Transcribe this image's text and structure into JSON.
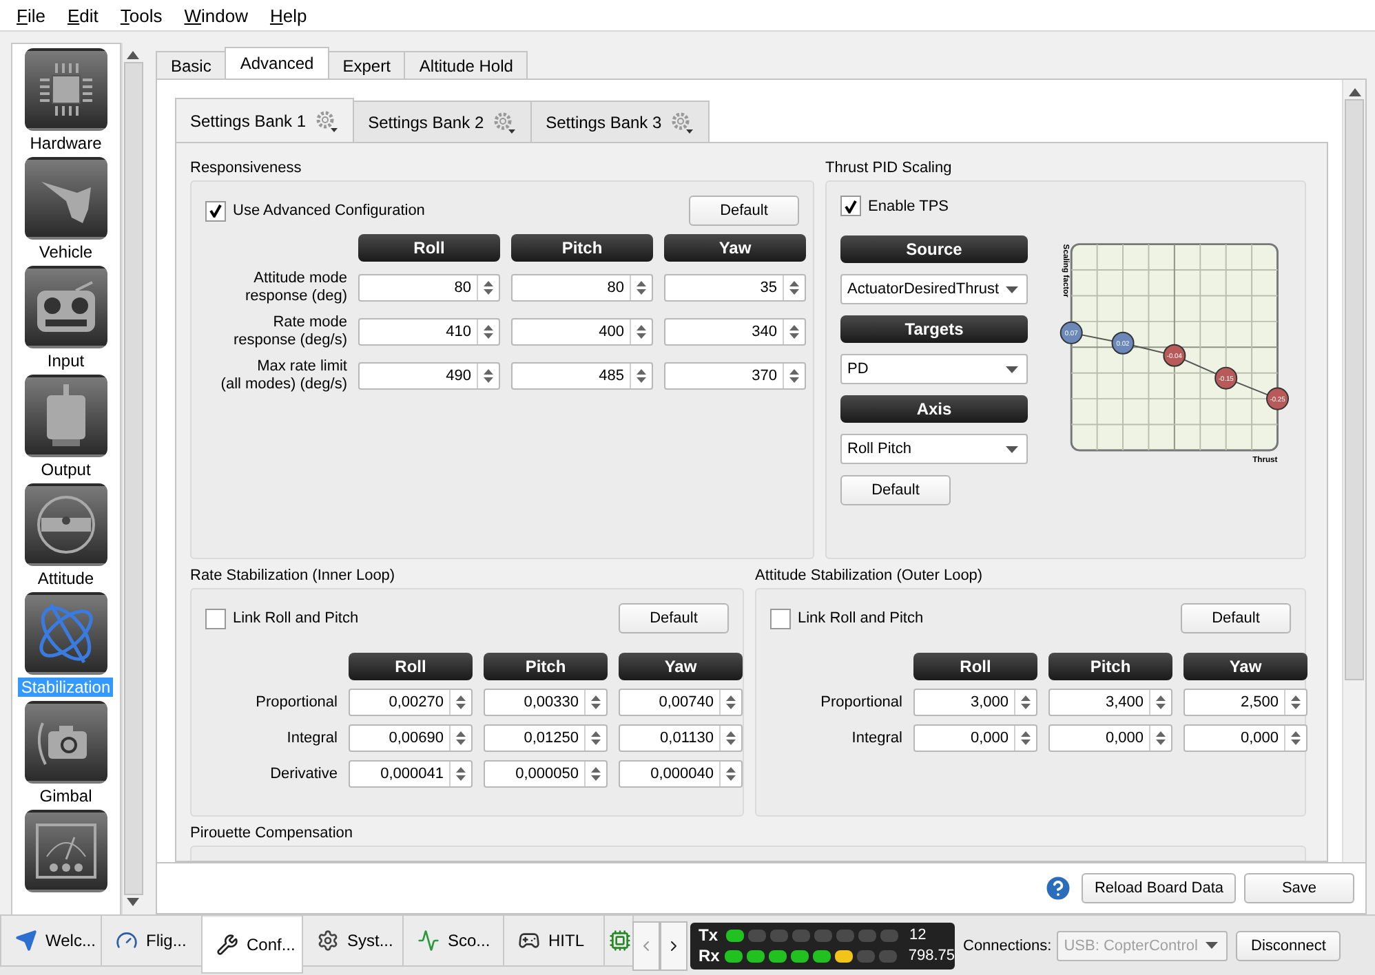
{
  "menu": [
    {
      "label": "File"
    },
    {
      "label": "Edit"
    },
    {
      "label": "Tools"
    },
    {
      "label": "Window"
    },
    {
      "label": "Help"
    }
  ],
  "sidebar": {
    "items": [
      {
        "label": "Hardware",
        "kind": "chip",
        "selected": false
      },
      {
        "label": "Vehicle",
        "kind": "plane",
        "selected": false
      },
      {
        "label": "Input",
        "kind": "radio",
        "selected": false
      },
      {
        "label": "Output",
        "kind": "motor",
        "selected": false
      },
      {
        "label": "Attitude",
        "kind": "level",
        "selected": false
      },
      {
        "label": "Stabilization",
        "kind": "gyro",
        "selected": true
      },
      {
        "label": "Gimbal",
        "kind": "camera",
        "selected": false
      },
      {
        "kind": "meter",
        "selected": false
      }
    ]
  },
  "tabs": [
    {
      "label": "Basic",
      "selected": false
    },
    {
      "label": "Advanced",
      "selected": true
    },
    {
      "label": "Expert",
      "selected": false
    },
    {
      "label": "Altitude Hold",
      "selected": false
    }
  ],
  "bank_tabs": [
    {
      "label": "Settings Bank 1",
      "selected": true
    },
    {
      "label": "Settings Bank 2",
      "selected": false
    },
    {
      "label": "Settings Bank 3",
      "selected": false
    }
  ],
  "responsiveness": {
    "title": "Responsiveness",
    "use_advanced": {
      "label": "Use Advanced Configuration",
      "checked": true
    },
    "default_button": "Default",
    "columns": [
      "Roll",
      "Pitch",
      "Yaw"
    ],
    "rows": [
      {
        "label": "Attitude mode\nresponse (deg)",
        "values": [
          "80",
          "80",
          "35"
        ]
      },
      {
        "label": "Rate mode\nresponse (deg/s)",
        "values": [
          "410",
          "400",
          "340"
        ]
      },
      {
        "label": "Max rate limit\n(all modes) (deg/s)",
        "values": [
          "490",
          "485",
          "370"
        ]
      }
    ]
  },
  "thrust_pid_scaling": {
    "title": "Thrust PID Scaling",
    "enable_tps": {
      "label": "Enable TPS",
      "checked": true
    },
    "source_header": "Source",
    "source_value": "ActuatorDesiredThrust",
    "targets_header": "Targets",
    "targets_value": "PD",
    "axis_header": "Axis",
    "axis_value": "Roll Pitch",
    "default_button": "Default",
    "chart_data": {
      "type": "line",
      "xlabel": "Thrust",
      "ylabel": "Scaling factor",
      "ylim": [
        -0.5,
        0.5
      ],
      "data_labels": true,
      "series": [
        {
          "color": "#555555",
          "marker": "o",
          "values": [
            0.07,
            0.02,
            -0.04,
            -0.15,
            -0.25
          ]
        }
      ]
    }
  },
  "rate_stabilization": {
    "title": "Rate Stabilization (Inner Loop)",
    "link": {
      "label": "Link Roll and Pitch",
      "checked": false
    },
    "default_button": "Default",
    "columns": [
      "Roll",
      "Pitch",
      "Yaw"
    ],
    "rows": [
      {
        "label": "Proportional",
        "values": [
          "0,00270",
          "0,00330",
          "0,00740"
        ]
      },
      {
        "label": "Integral",
        "values": [
          "0,00690",
          "0,01250",
          "0,01130"
        ]
      },
      {
        "label": "Derivative",
        "values": [
          "0,000041",
          "0,000050",
          "0,000040"
        ]
      }
    ]
  },
  "attitude_stabilization": {
    "title": "Attitude Stabilization (Outer Loop)",
    "link": {
      "label": "Link Roll and Pitch",
      "checked": false
    },
    "default_button": "Default",
    "columns": [
      "Roll",
      "Pitch",
      "Yaw"
    ],
    "rows": [
      {
        "label": "Proportional",
        "values": [
          "3,000",
          "3,400",
          "2,500"
        ]
      },
      {
        "label": "Integral",
        "values": [
          "0,000",
          "0,000",
          "0,000"
        ]
      }
    ]
  },
  "pirouette": {
    "title": "Pirouette Compensation"
  },
  "footer_buttons": [
    "Reload Board Data",
    "Save"
  ],
  "bottom_tabs": [
    {
      "label": "Welc...",
      "kind": "welcome",
      "selected": false
    },
    {
      "label": "Flig...",
      "kind": "flight",
      "selected": false
    },
    {
      "label": "Conf...",
      "kind": "config",
      "selected": true
    },
    {
      "label": "Syst...",
      "kind": "system",
      "selected": false
    },
    {
      "label": "Sco...",
      "kind": "scopes",
      "selected": false
    },
    {
      "label": "HITL",
      "kind": "hitl",
      "selected": false
    },
    {
      "kind": "board",
      "selected": false
    }
  ],
  "telemetry": {
    "tx": {
      "label": "Tx",
      "level": 0.125,
      "reading": "12"
    },
    "rx": {
      "label": "Rx",
      "level": 0.75,
      "reading": "798.75"
    }
  },
  "connections": {
    "label": "Connections:",
    "device": "USB: CopterControl",
    "disabled": true,
    "disconnect_button": "Disconnect"
  }
}
